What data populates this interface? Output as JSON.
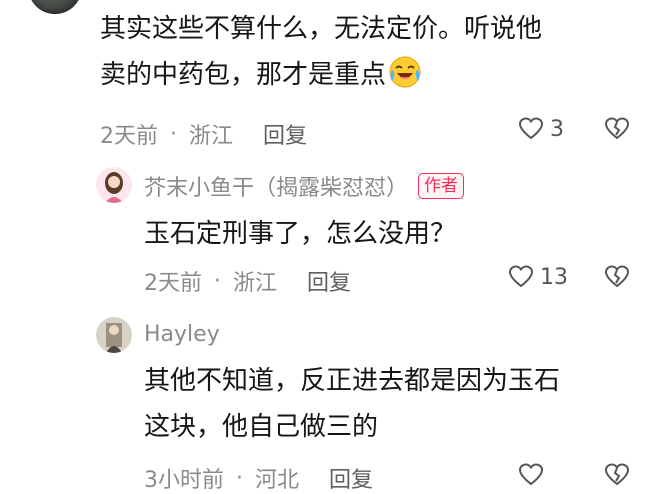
{
  "comments": [
    {
      "text_line1": "其实这些不算什么，无法定价。听说他",
      "text_line2": "卖的中药包，那才是重点",
      "emoji": "laughing-crying-emoji",
      "time": "2天前",
      "location": "浙江",
      "reply_label": "回复",
      "likes": "3"
    },
    {
      "username": "芥末小鱼干（揭露柴怼怼）",
      "badge": "作者",
      "text_line1": "玉石定刑事了，怎么没用？",
      "time": "2天前",
      "location": "浙江",
      "reply_label": "回复",
      "likes": "13"
    },
    {
      "username": "Hayley",
      "text_line1": "其他不知道，反正进去都是因为玉石",
      "text_line2": "这块，他自己做三的",
      "time": "3小时前",
      "location": "河北",
      "reply_label": "回复"
    }
  ],
  "separator": "·",
  "colors": {
    "author_badge": "#f2325a",
    "meta_text": "#8a8a8a",
    "body_text": "#161616"
  },
  "icons": [
    "heart-outline-icon",
    "broken-heart-icon"
  ]
}
